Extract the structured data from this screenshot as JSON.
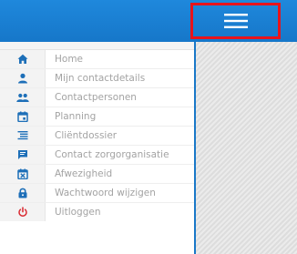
{
  "colors": {
    "header": "#1677c9",
    "accent": "#1978c8",
    "icon": "#1d6fb8",
    "logout_icon": "#d9262e",
    "highlight": "#e8131b",
    "label": "#a3a3a3"
  },
  "header": {
    "menu_icon": "hamburger-menu-icon"
  },
  "sidebar": {
    "items": [
      {
        "label": "Home",
        "icon": "home-icon"
      },
      {
        "label": "Mijn contactdetails",
        "icon": "person-icon"
      },
      {
        "label": "Contactpersonen",
        "icon": "people-icon"
      },
      {
        "label": "Planning",
        "icon": "calendar-icon"
      },
      {
        "label": "Cliëntdossier",
        "icon": "list-icon"
      },
      {
        "label": "Contact zorgorganisatie",
        "icon": "chat-icon"
      },
      {
        "label": "Afwezigheid",
        "icon": "calendar-cross-icon"
      },
      {
        "label": "Wachtwoord wijzigen",
        "icon": "lock-icon"
      },
      {
        "label": "Uitloggen",
        "icon": "power-icon"
      }
    ]
  }
}
